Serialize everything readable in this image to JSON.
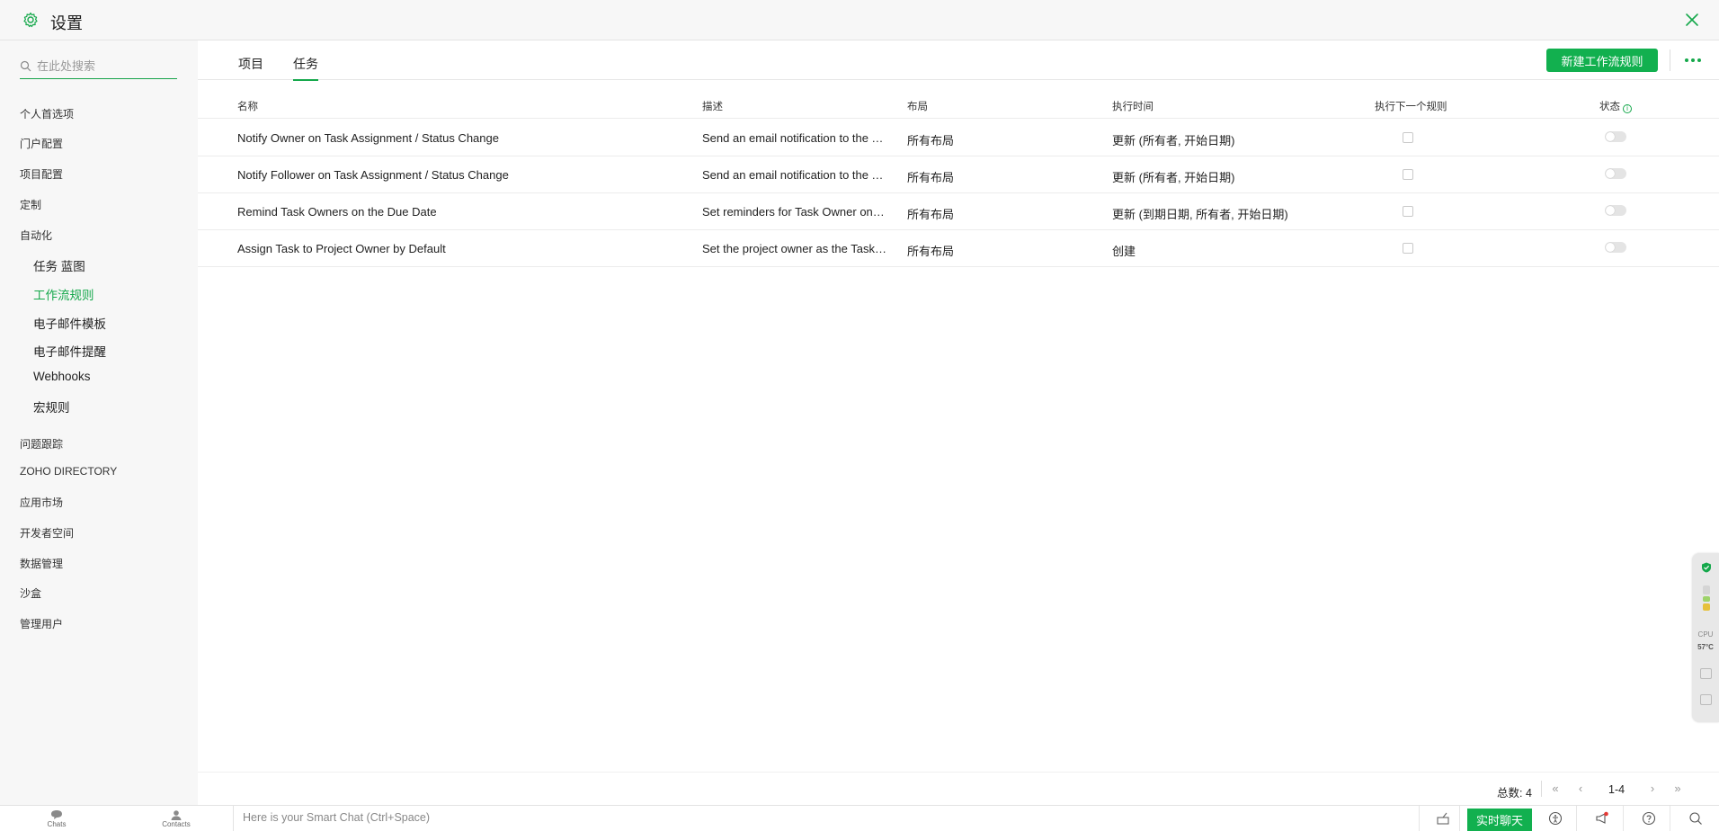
{
  "header": {
    "title": "设置"
  },
  "sidebar": {
    "search_placeholder": "在此处搜索",
    "items": [
      "个人首选项",
      "门户配置",
      "项目配置",
      "定制",
      "自动化"
    ],
    "automation_sub": [
      {
        "label": "任务 蓝图",
        "active": false
      },
      {
        "label": "工作流规则",
        "active": true
      },
      {
        "label": "电子邮件模板",
        "active": false
      },
      {
        "label": "电子邮件提醒",
        "active": false
      },
      {
        "label": "Webhooks",
        "active": false
      },
      {
        "label": "宏规则",
        "active": false
      }
    ],
    "items_after": [
      "问题跟踪",
      "ZOHO DIRECTORY",
      "应用市场",
      "开发者空间",
      "数据管理",
      "沙盒",
      "管理用户"
    ]
  },
  "tabs": [
    {
      "label": "项目",
      "active": false
    },
    {
      "label": "任务",
      "active": true
    }
  ],
  "toolbar": {
    "new_rule_label": "新建工作流规则"
  },
  "table": {
    "columns": [
      "名称",
      "描述",
      "布局",
      "执行时间",
      "执行下一个规则",
      "状态"
    ],
    "rows": [
      {
        "name": "Notify Owner on Task Assignment / Status Change",
        "description": "Send an email notification to the T...",
        "layout": "所有布局",
        "execute": "更新 (所有者, 开始日期)"
      },
      {
        "name": "Notify Follower on Task Assignment / Status Change",
        "description": "Send an email notification to the T...",
        "layout": "所有布局",
        "execute": "更新 (所有者, 开始日期)"
      },
      {
        "name": "Remind Task Owners on the Due Date",
        "description": "Set reminders for Task Owner on t...",
        "layout": "所有布局",
        "execute": "更新 (到期日期, 所有者, 开始日期)"
      },
      {
        "name": "Assign Task to Project Owner by Default",
        "description": "Set the project owner as the Task ...",
        "layout": "所有布局",
        "execute": "创建"
      }
    ]
  },
  "pager": {
    "total": "总数: 4",
    "range": "1-4"
  },
  "bottombar": {
    "chats": "Chats",
    "contacts": "Contacts",
    "chat_placeholder": "Here is your Smart Chat (Ctrl+Space)",
    "live_chat": "实时聊天"
  },
  "widget": {
    "cpu_label": "CPU",
    "cpu_temp": "57°C"
  },
  "colors": {
    "accent": "#12b04f",
    "active_text": "#15a84b"
  }
}
